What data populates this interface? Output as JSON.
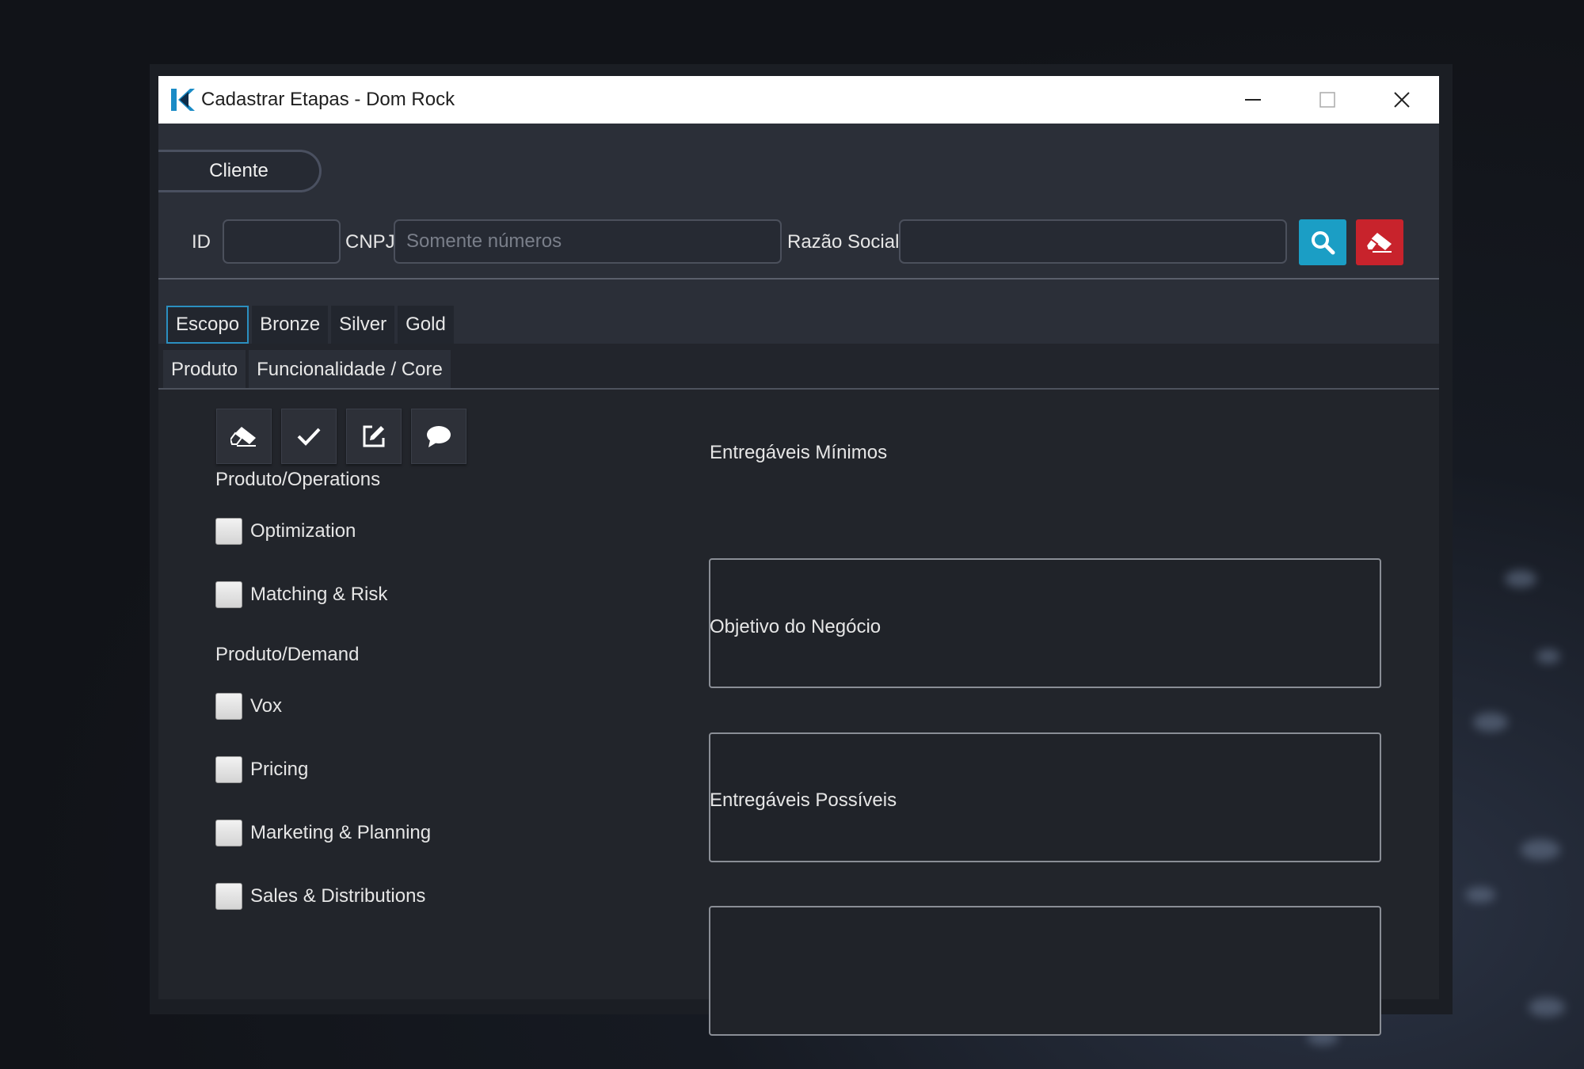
{
  "window": {
    "title": "Cadastrar Etapas - Dom Rock",
    "controls": [
      "minimize",
      "maximize",
      "close"
    ]
  },
  "client_section": {
    "label": "Cliente",
    "id_label": "ID",
    "id_value": "",
    "cnpj_label": "CNPJ",
    "cnpj_placeholder": "Somente números",
    "cnpj_value": "",
    "razao_label": "Razão Social",
    "razao_value": "",
    "search_icon": "search-icon",
    "clear_icon": "eraser-icon"
  },
  "tabs_level1": [
    {
      "label": "Escopo",
      "active": true
    },
    {
      "label": "Bronze",
      "active": false
    },
    {
      "label": "Silver",
      "active": false
    },
    {
      "label": "Gold",
      "active": false
    }
  ],
  "tabs_level2": [
    {
      "label": "Produto",
      "active": true
    },
    {
      "label": "Funcionalidade / Core",
      "active": false
    }
  ],
  "toolbar": [
    "eraser-icon",
    "check-icon",
    "edit-icon",
    "comment-icon"
  ],
  "groups": [
    {
      "label": "Produto/Operations",
      "items": [
        {
          "label": "Optimization",
          "checked": false
        },
        {
          "label": "Matching & Risk",
          "checked": false
        }
      ]
    },
    {
      "label": "Produto/Demand",
      "items": [
        {
          "label": "Vox",
          "checked": false
        },
        {
          "label": "Pricing",
          "checked": false
        },
        {
          "label": "Marketing & Planning",
          "checked": false
        },
        {
          "label": "Sales & Distributions",
          "checked": false
        }
      ]
    }
  ],
  "text_areas": [
    {
      "label": "Entregáveis Mínimos",
      "value": ""
    },
    {
      "label": "Objetivo do Negócio",
      "value": ""
    },
    {
      "label": "Entregáveis Possíveis",
      "value": ""
    }
  ],
  "colors": {
    "accent": "#2b8fc0",
    "search_button": "#1b9ec5",
    "clear_button": "#c8232c",
    "background": "#2b2f38"
  }
}
